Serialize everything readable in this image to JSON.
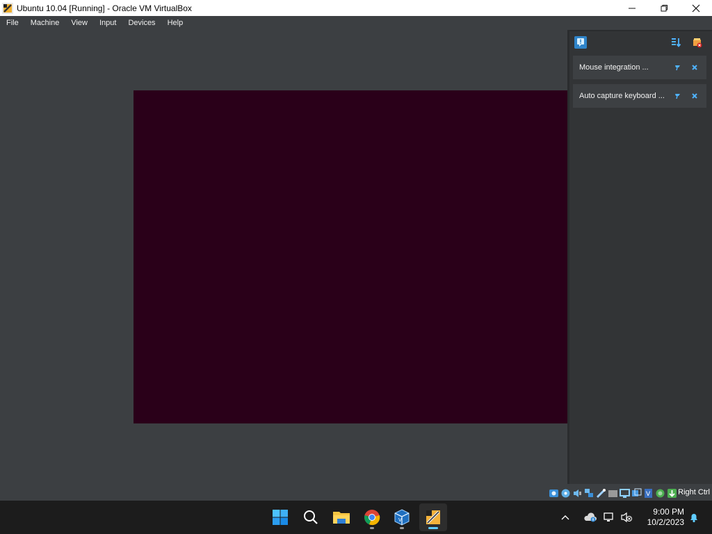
{
  "window": {
    "title": "Ubuntu 10.04 [Running] - Oracle VM VirtualBox",
    "controls": [
      "minimize",
      "maximize",
      "close"
    ]
  },
  "menu": [
    "File",
    "Machine",
    "View",
    "Input",
    "Devices",
    "Help"
  ],
  "notification_center": {
    "toolbar_icons": [
      "notification-toggle-icon",
      "sort-icon",
      "clear-all-icon"
    ],
    "items": [
      {
        "text": "Mouse integration ...",
        "actions": [
          "pin-icon",
          "close-icon"
        ]
      },
      {
        "text": "Auto capture keyboard ...",
        "actions": [
          "pin-icon",
          "close-icon"
        ]
      }
    ]
  },
  "statusbar": {
    "icons": [
      "hard-disk-icon",
      "optical-drive-icon",
      "audio-icon",
      "network-icon",
      "usb-icon",
      "shared-folders-icon",
      "display-icon",
      "recording-icon",
      "cpu-icon",
      "guest-additions-icon",
      "mouse-integration-icon",
      "keyboard-capture-icon"
    ],
    "host_key": "Right Ctrl"
  },
  "taskbar": {
    "apps": [
      "start-icon",
      "search-icon",
      "file-explorer-icon",
      "chrome-icon",
      "virtualbox-manager-icon",
      "virtualbox-vm-icon"
    ],
    "tray_icons": [
      "show-hidden-icons-chevron",
      "onedrive-icon",
      "network-icon",
      "volume-muted-icon"
    ],
    "time": "9:00 PM",
    "date": "10/2/2023",
    "notifications_icon": "bell-icon"
  },
  "colors": {
    "vm_background": "#3c3f42",
    "guest_screen": "#2a0019",
    "accent": "#60cdff"
  }
}
